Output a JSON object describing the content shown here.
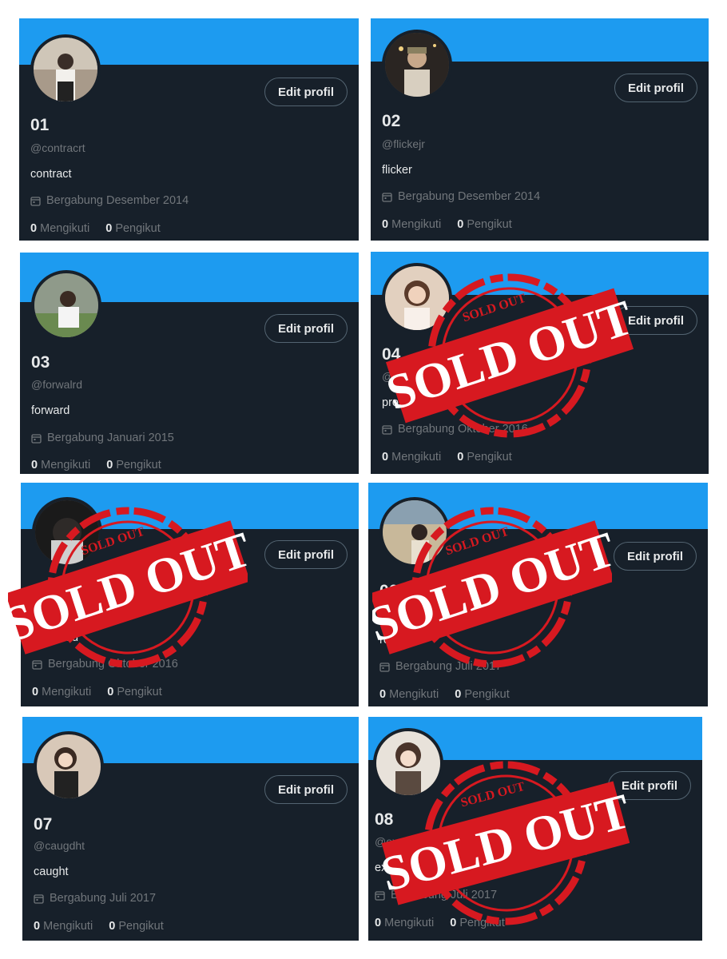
{
  "edit_label": "Edit profil",
  "following_label": "Mengikuti",
  "followers_label": "Pengikut",
  "stamp_text": "SOLD OUT",
  "colors": {
    "banner": "#1d9bf0",
    "card": "#17202a",
    "stamp": "#d71920"
  },
  "cards": [
    {
      "num": "01",
      "handle": "@contracrt",
      "bio": "contract",
      "joined": "Bergabung Desember 2014",
      "following": "0",
      "followers": "0",
      "sold_out": false
    },
    {
      "num": "02",
      "handle": "@flickejr",
      "bio": "flicker",
      "joined": "Bergabung Desember 2014",
      "following": "0",
      "followers": "0",
      "sold_out": false
    },
    {
      "num": "03",
      "handle": "@forwalrd",
      "bio": "forward",
      "joined": "Bergabung Januari 2015",
      "following": "0",
      "followers": "0",
      "sold_out": false
    },
    {
      "num": "04",
      "handle": "@",
      "bio": "profe",
      "joined": "Bergabung Oktober 2016",
      "following": "0",
      "followers": "0",
      "sold_out": true
    },
    {
      "num": "",
      "handle": "",
      "bio": "achieved",
      "joined": "Bergabung Oktober 2016",
      "following": "0",
      "followers": "0",
      "sold_out": true
    },
    {
      "num": "06",
      "handle": "",
      "bio": "revi",
      "joined": "Bergabung Juli 2017",
      "following": "0",
      "followers": "0",
      "sold_out": true
    },
    {
      "num": "07",
      "handle": "@caugdht",
      "bio": "caught",
      "joined": "Bergabung Juli 2017",
      "following": "0",
      "followers": "0",
      "sold_out": false
    },
    {
      "num": "08",
      "handle": "@ex",
      "bio": "exc",
      "joined": "Bergabung Juli 2017",
      "following": "0",
      "followers": "0",
      "sold_out": true
    }
  ]
}
